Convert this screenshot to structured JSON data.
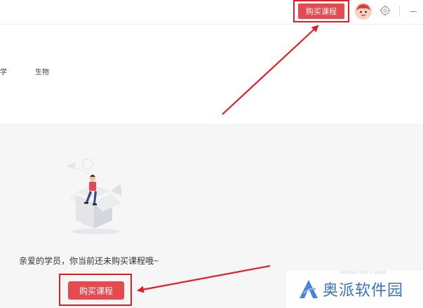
{
  "header": {
    "buy_label": "购买课程",
    "avatar_icon": "student-avatar-icon",
    "settings_icon": "gear-icon",
    "minimize_icon": "minimize-icon"
  },
  "subjects": {
    "items": [
      {
        "label": "学"
      },
      {
        "label": "生物"
      }
    ]
  },
  "empty_state": {
    "illustration": "empty-box-illustration",
    "message": "亲爱的学员，你当前还未购买课程哦~",
    "buy_label": "购买课程"
  },
  "annotations": {
    "highlight_color": "#e41e26"
  },
  "watermark": {
    "text": "奥派软件园",
    "url": "AOPAI.SOFT.COM",
    "color": "#2c67b8"
  },
  "colors": {
    "accent": "#e64a4f",
    "background": "#f6f6f6"
  }
}
